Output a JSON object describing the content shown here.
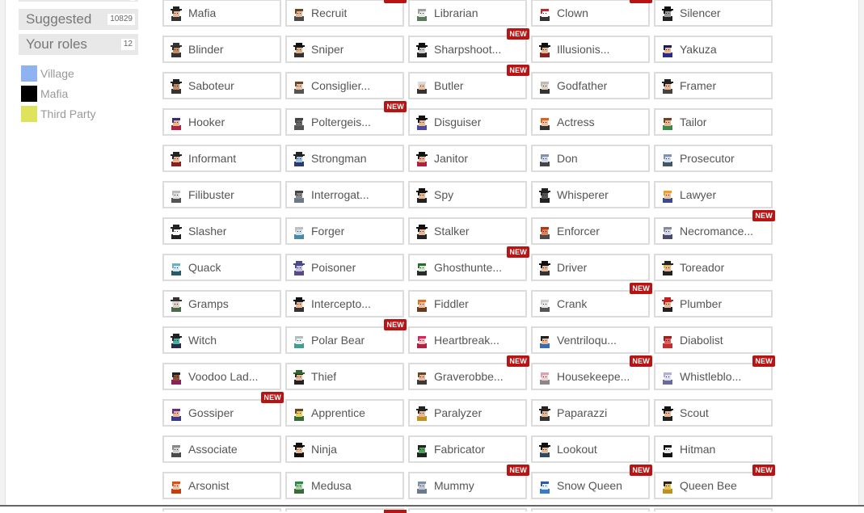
{
  "sidebar": {
    "tabs": [
      {
        "label": "",
        "count": ""
      },
      {
        "label": "Suggested",
        "count": "10829"
      },
      {
        "label": "Your roles",
        "count": "12"
      }
    ],
    "legend": [
      {
        "label": "Village",
        "color": "#8fb3f0"
      },
      {
        "label": "Mafia",
        "color": "#000000"
      },
      {
        "label": "Third Party",
        "color": "#dfe35c"
      }
    ]
  },
  "badge_text": "NEW",
  "roles": [
    {
      "name": "Mafia",
      "new": false,
      "skin": "#e8b896",
      "hair": "#2a2a2a",
      "hat": "#222222",
      "body": "#333333"
    },
    {
      "name": "Recruit",
      "new": true,
      "skin": "#e8b896",
      "hair": "#6b4423",
      "hat": "",
      "body": "#4a4a4a"
    },
    {
      "name": "Librarian",
      "new": false,
      "skin": "#e8e8e8",
      "hair": "#a0a0a0",
      "hat": "",
      "body": "#5a7a5a"
    },
    {
      "name": "Clown",
      "new": true,
      "skin": "#ffffff",
      "hair": "#d02020",
      "hat": "",
      "body": "#333333"
    },
    {
      "name": "Silencer",
      "new": false,
      "skin": "#9a9a9a",
      "hair": "#111111",
      "hat": "#111111",
      "body": "#222222"
    },
    {
      "name": "Blinder",
      "new": false,
      "skin": "#c48a60",
      "hair": "#222222",
      "hat": "#333333",
      "body": "#333333"
    },
    {
      "name": "Sniper",
      "new": false,
      "skin": "#e0b088",
      "hair": "#222222",
      "hat": "#111111",
      "body": "#333333"
    },
    {
      "name": "Sharpshoot...",
      "new": true,
      "skin": "#cccccc",
      "hair": "#111111",
      "hat": "#111111",
      "body": "#222222"
    },
    {
      "name": "Illusionis...",
      "new": false,
      "skin": "#e8b896",
      "hair": "#222222",
      "hat": "#111111",
      "body": "#8a2020"
    },
    {
      "name": "Yakuza",
      "new": false,
      "skin": "#e8b896",
      "hair": "#1a1a5a",
      "hat": "",
      "body": "#2a2a8a"
    },
    {
      "name": "Saboteur",
      "new": false,
      "skin": "#c48a60",
      "hair": "#222222",
      "hat": "#222222",
      "body": "#333333"
    },
    {
      "name": "Consiglier...",
      "new": false,
      "skin": "#e8c0a0",
      "hair": "#6b4423",
      "hat": "",
      "body": "#555555"
    },
    {
      "name": "Butler",
      "new": true,
      "skin": "#e8c0a0",
      "hair": "#dddddd",
      "hat": "",
      "body": "#333333"
    },
    {
      "name": "Godfather",
      "new": false,
      "skin": "#e0d0c0",
      "hair": "#bbbbbb",
      "hat": "",
      "body": "#333333"
    },
    {
      "name": "Framer",
      "new": false,
      "skin": "#e8b896",
      "hair": "#222222",
      "hat": "#222222",
      "body": "#444444"
    },
    {
      "name": "Hooker",
      "new": false,
      "skin": "#e8b896",
      "hair": "#3a2a7a",
      "hat": "",
      "body": "#b02040"
    },
    {
      "name": "Poltergeis...",
      "new": true,
      "skin": "#666666",
      "hair": "#444444",
      "hat": "",
      "body": "#555555"
    },
    {
      "name": "Disguiser",
      "new": false,
      "skin": "#e8b896",
      "hair": "#111111",
      "hat": "#111111",
      "body": "#4a4aa0"
    },
    {
      "name": "Actress",
      "new": false,
      "skin": "#f0c0a0",
      "hair": "#e06020",
      "hat": "",
      "body": "#333333"
    },
    {
      "name": "Tailor",
      "new": false,
      "skin": "#e8b896",
      "hair": "#6b4423",
      "hat": "",
      "body": "#3a8a4a"
    },
    {
      "name": "Informant",
      "new": false,
      "skin": "#e8b896",
      "hair": "#222222",
      "hat": "#222222",
      "body": "#8a2020"
    },
    {
      "name": "Strongman",
      "new": false,
      "skin": "#a0c0e0",
      "hair": "#222222",
      "hat": "#222222",
      "body": "#2a3a6a"
    },
    {
      "name": "Janitor",
      "new": false,
      "skin": "#e8b896",
      "hair": "#222222",
      "hat": "#111111",
      "body": "#b02040"
    },
    {
      "name": "Don",
      "new": false,
      "skin": "#d0d8e8",
      "hair": "#8090b0",
      "hat": "",
      "body": "#444444"
    },
    {
      "name": "Prosecutor",
      "new": false,
      "skin": "#d0e0f0",
      "hair": "#8090b0",
      "hat": "",
      "body": "#445566"
    },
    {
      "name": "Filibuster",
      "new": false,
      "skin": "#e0e0e0",
      "hair": "#bbbbbb",
      "hat": "",
      "body": "#555555"
    },
    {
      "name": "Interrogat...",
      "new": false,
      "skin": "#888888",
      "hair": "#444444",
      "hat": "",
      "body": "#6a7a8a"
    },
    {
      "name": "Spy",
      "new": false,
      "skin": "#e8b896",
      "hair": "#111111",
      "hat": "#111111",
      "body": "#222222"
    },
    {
      "name": "Whisperer",
      "new": false,
      "skin": "#555555",
      "hair": "#222222",
      "hat": "#222222",
      "body": "#222222"
    },
    {
      "name": "Lawyer",
      "new": false,
      "skin": "#f0c0a0",
      "hair": "#f0a020",
      "hat": "",
      "body": "#3a4a8a"
    },
    {
      "name": "Slasher",
      "new": false,
      "skin": "#ffffff",
      "hair": "#222222",
      "hat": "#222222",
      "body": "#222222"
    },
    {
      "name": "Forger",
      "new": false,
      "skin": "#d0e0f0",
      "hair": "#c0c0c0",
      "hat": "",
      "body": "#4a8aa0"
    },
    {
      "name": "Stalker",
      "new": false,
      "skin": "#e8b896",
      "hair": "#111111",
      "hat": "#111111",
      "body": "#222222"
    },
    {
      "name": "Enforcer",
      "new": false,
      "skin": "#e08050",
      "hair": "#c03010",
      "hat": "",
      "body": "#4a4a4a"
    },
    {
      "name": "Necromance...",
      "new": true,
      "skin": "#d0d8e8",
      "hair": "#8a8a9a",
      "hat": "",
      "body": "#4a4a6a"
    },
    {
      "name": "Quack",
      "new": false,
      "skin": "#d0e8f0",
      "hair": "#6ab0c0",
      "hat": "",
      "body": "#2a5a6a"
    },
    {
      "name": "Poisoner",
      "new": false,
      "skin": "#c0c0e0",
      "hair": "#4a4a8a",
      "hat": "#4a4a8a",
      "body": "#5a4a8a"
    },
    {
      "name": "Ghosthunte...",
      "new": true,
      "skin": "#d0e8d0",
      "hair": "#2a6a2a",
      "hat": "",
      "body": "#2a2a2a"
    },
    {
      "name": "Driver",
      "new": false,
      "skin": "#e8b896",
      "hair": "#111111",
      "hat": "#111111",
      "body": "#333333"
    },
    {
      "name": "Toreador",
      "new": false,
      "skin": "#e8b896",
      "hair": "#e0c030",
      "hat": "#222222",
      "body": "#222222"
    },
    {
      "name": "Gramps",
      "new": false,
      "skin": "#e0d0c0",
      "hair": "#dddddd",
      "hat": "#333333",
      "body": "#4a6a4a"
    },
    {
      "name": "Intercepto...",
      "new": false,
      "skin": "#e8b896",
      "hair": "#222222",
      "hat": "#111111",
      "body": "#333333"
    },
    {
      "name": "Fiddler",
      "new": false,
      "skin": "#f0c0a0",
      "hair": "#e07020",
      "hat": "",
      "body": "#6a3a20"
    },
    {
      "name": "Crank",
      "new": true,
      "skin": "#e8e8e8",
      "hair": "#cccccc",
      "hat": "",
      "body": "#555555"
    },
    {
      "name": "Plumber",
      "new": false,
      "skin": "#e8b896",
      "hair": "#c02020",
      "hat": "#c02020",
      "body": "#222222"
    },
    {
      "name": "Witch",
      "new": false,
      "skin": "#4ab0a0",
      "hair": "#222222",
      "hat": "#222222",
      "body": "#2a2a4a"
    },
    {
      "name": "Polar Bear",
      "new": true,
      "skin": "#e8f0f0",
      "hair": "#b0c0c0",
      "hat": "",
      "body": "#40a090"
    },
    {
      "name": "Heartbreak...",
      "new": false,
      "skin": "#f0c0c0",
      "hair": "#e02060",
      "hat": "",
      "body": "#b02040"
    },
    {
      "name": "Ventriloqu...",
      "new": false,
      "skin": "#e8b896",
      "hair": "#222222",
      "hat": "",
      "body": "#3a6ab0"
    },
    {
      "name": "Diabolist",
      "new": false,
      "skin": "#e06060",
      "hair": "#a02020",
      "hat": "",
      "body": "#c03030"
    },
    {
      "name": "Voodoo Lad...",
      "new": false,
      "skin": "#8a5030",
      "hair": "#222222",
      "hat": "",
      "body": "#8a2060"
    },
    {
      "name": "Thief",
      "new": false,
      "skin": "#e8b896",
      "hair": "#222222",
      "hat": "#2a6a2a",
      "body": "#222222"
    },
    {
      "name": "Graverobbe...",
      "new": true,
      "skin": "#e8b896",
      "hair": "#6b4423",
      "hat": "",
      "body": "#3a3a3a"
    },
    {
      "name": "Housekeepe...",
      "new": true,
      "skin": "#f0d0d0",
      "hair": "#e0a0b0",
      "hat": "",
      "body": "#888888"
    },
    {
      "name": "Whistleblo...",
      "new": true,
      "skin": "#e0e0f0",
      "hair": "#b0b0d0",
      "hat": "",
      "body": "#6a6aa0"
    },
    {
      "name": "Gossiper",
      "new": true,
      "skin": "#e8b896",
      "hair": "#6a2a8a",
      "hat": "",
      "body": "#3a3a8a"
    },
    {
      "name": "Apprentice",
      "new": false,
      "skin": "#e8d060",
      "hair": "#6b4423",
      "hat": "",
      "body": "#3a6a3a"
    },
    {
      "name": "Paralyzer",
      "new": false,
      "skin": "#e8b896",
      "hair": "#222222",
      "hat": "#222222",
      "body": "#c09020"
    },
    {
      "name": "Paparazzi",
      "new": false,
      "skin": "#e8b896",
      "hair": "#222222",
      "hat": "#222222",
      "body": "#333333"
    },
    {
      "name": "Scout",
      "new": false,
      "skin": "#e8b896",
      "hair": "#111111",
      "hat": "#111111",
      "body": "#222222"
    },
    {
      "name": "Associate",
      "new": false,
      "skin": "#d0d0d0",
      "hair": "#888888",
      "hat": "",
      "body": "#4a4a4a"
    },
    {
      "name": "Ninja",
      "new": false,
      "skin": "#e8b896",
      "hair": "#111111",
      "hat": "#111111",
      "body": "#111111"
    },
    {
      "name": "Fabricator",
      "new": false,
      "skin": "#50a060",
      "hair": "#222222",
      "hat": "",
      "body": "#222222"
    },
    {
      "name": "Lookout",
      "new": false,
      "skin": "#e8b896",
      "hair": "#111111",
      "hat": "#111111",
      "body": "#2a4a6a"
    },
    {
      "name": "Hitman",
      "new": false,
      "skin": "#e8e8e8",
      "hair": "#111111",
      "hat": "",
      "body": "#111111"
    },
    {
      "name": "Arsonist",
      "new": false,
      "skin": "#f0c0a0",
      "hair": "#e05010",
      "hat": "",
      "body": "#c04010"
    },
    {
      "name": "Medusa",
      "new": false,
      "skin": "#a0d0a0",
      "hair": "#2a8a4a",
      "hat": "",
      "body": "#3a6a3a"
    },
    {
      "name": "Mummy",
      "new": true,
      "skin": "#c0c8d8",
      "hair": "#8090a0",
      "hat": "",
      "body": "#6a7a8a"
    },
    {
      "name": "Snow Queen",
      "new": true,
      "skin": "#e0f0ff",
      "hair": "#2a5aa0",
      "hat": "",
      "body": "#3a7ac0"
    },
    {
      "name": "Queen Bee",
      "new": true,
      "skin": "#e8c060",
      "hair": "#222222",
      "hat": "",
      "body": "#c09020"
    }
  ],
  "partial_row_badges": [
    false,
    true,
    false,
    false,
    false
  ]
}
